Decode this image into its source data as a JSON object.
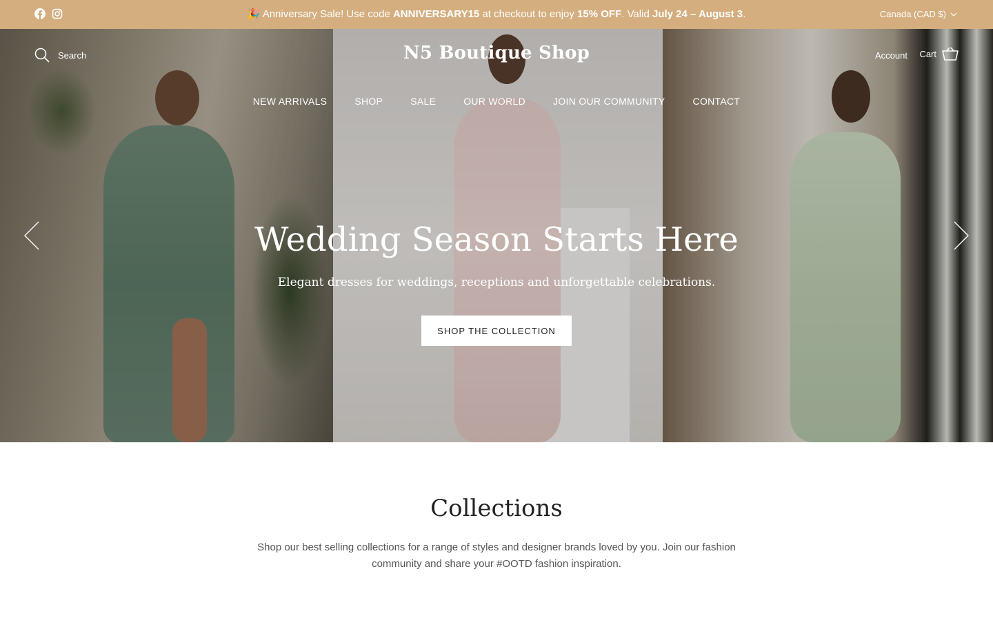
{
  "announcement": {
    "prefix": "🎉 Anniversary Sale! Use code ",
    "code": "ANNIVERSARY15",
    "middle": " at checkout to enjoy ",
    "discount": "15% OFF",
    "validity_prefix": ". Valid ",
    "dates": "July 24 – August 3",
    "suffix": ".",
    "currency": "Canada (CAD $)"
  },
  "socials": [
    "facebook-icon",
    "instagram-icon"
  ],
  "header": {
    "search_label": "Search",
    "logo": "N5 Boutique Shop",
    "account_label": "Account",
    "cart_label": "Cart"
  },
  "nav": [
    "NEW ARRIVALS",
    "SHOP",
    "SALE",
    "OUR WORLD",
    "JOIN OUR COMMUNITY",
    "CONTACT"
  ],
  "hero": {
    "title": "Wedding Season Starts Here",
    "subtitle": "Elegant dresses for weddings, receptions and unforgettable celebrations.",
    "cta": "SHOP THE COLLECTION"
  },
  "collections": {
    "title": "Collections",
    "description": "Shop our best selling collections for a range of styles and designer brands loved by you. Join our fashion community and share your #OOTD fashion inspiration."
  },
  "colors": {
    "announcement_bg": "#d4ae7f",
    "text_dark": "#222222"
  }
}
